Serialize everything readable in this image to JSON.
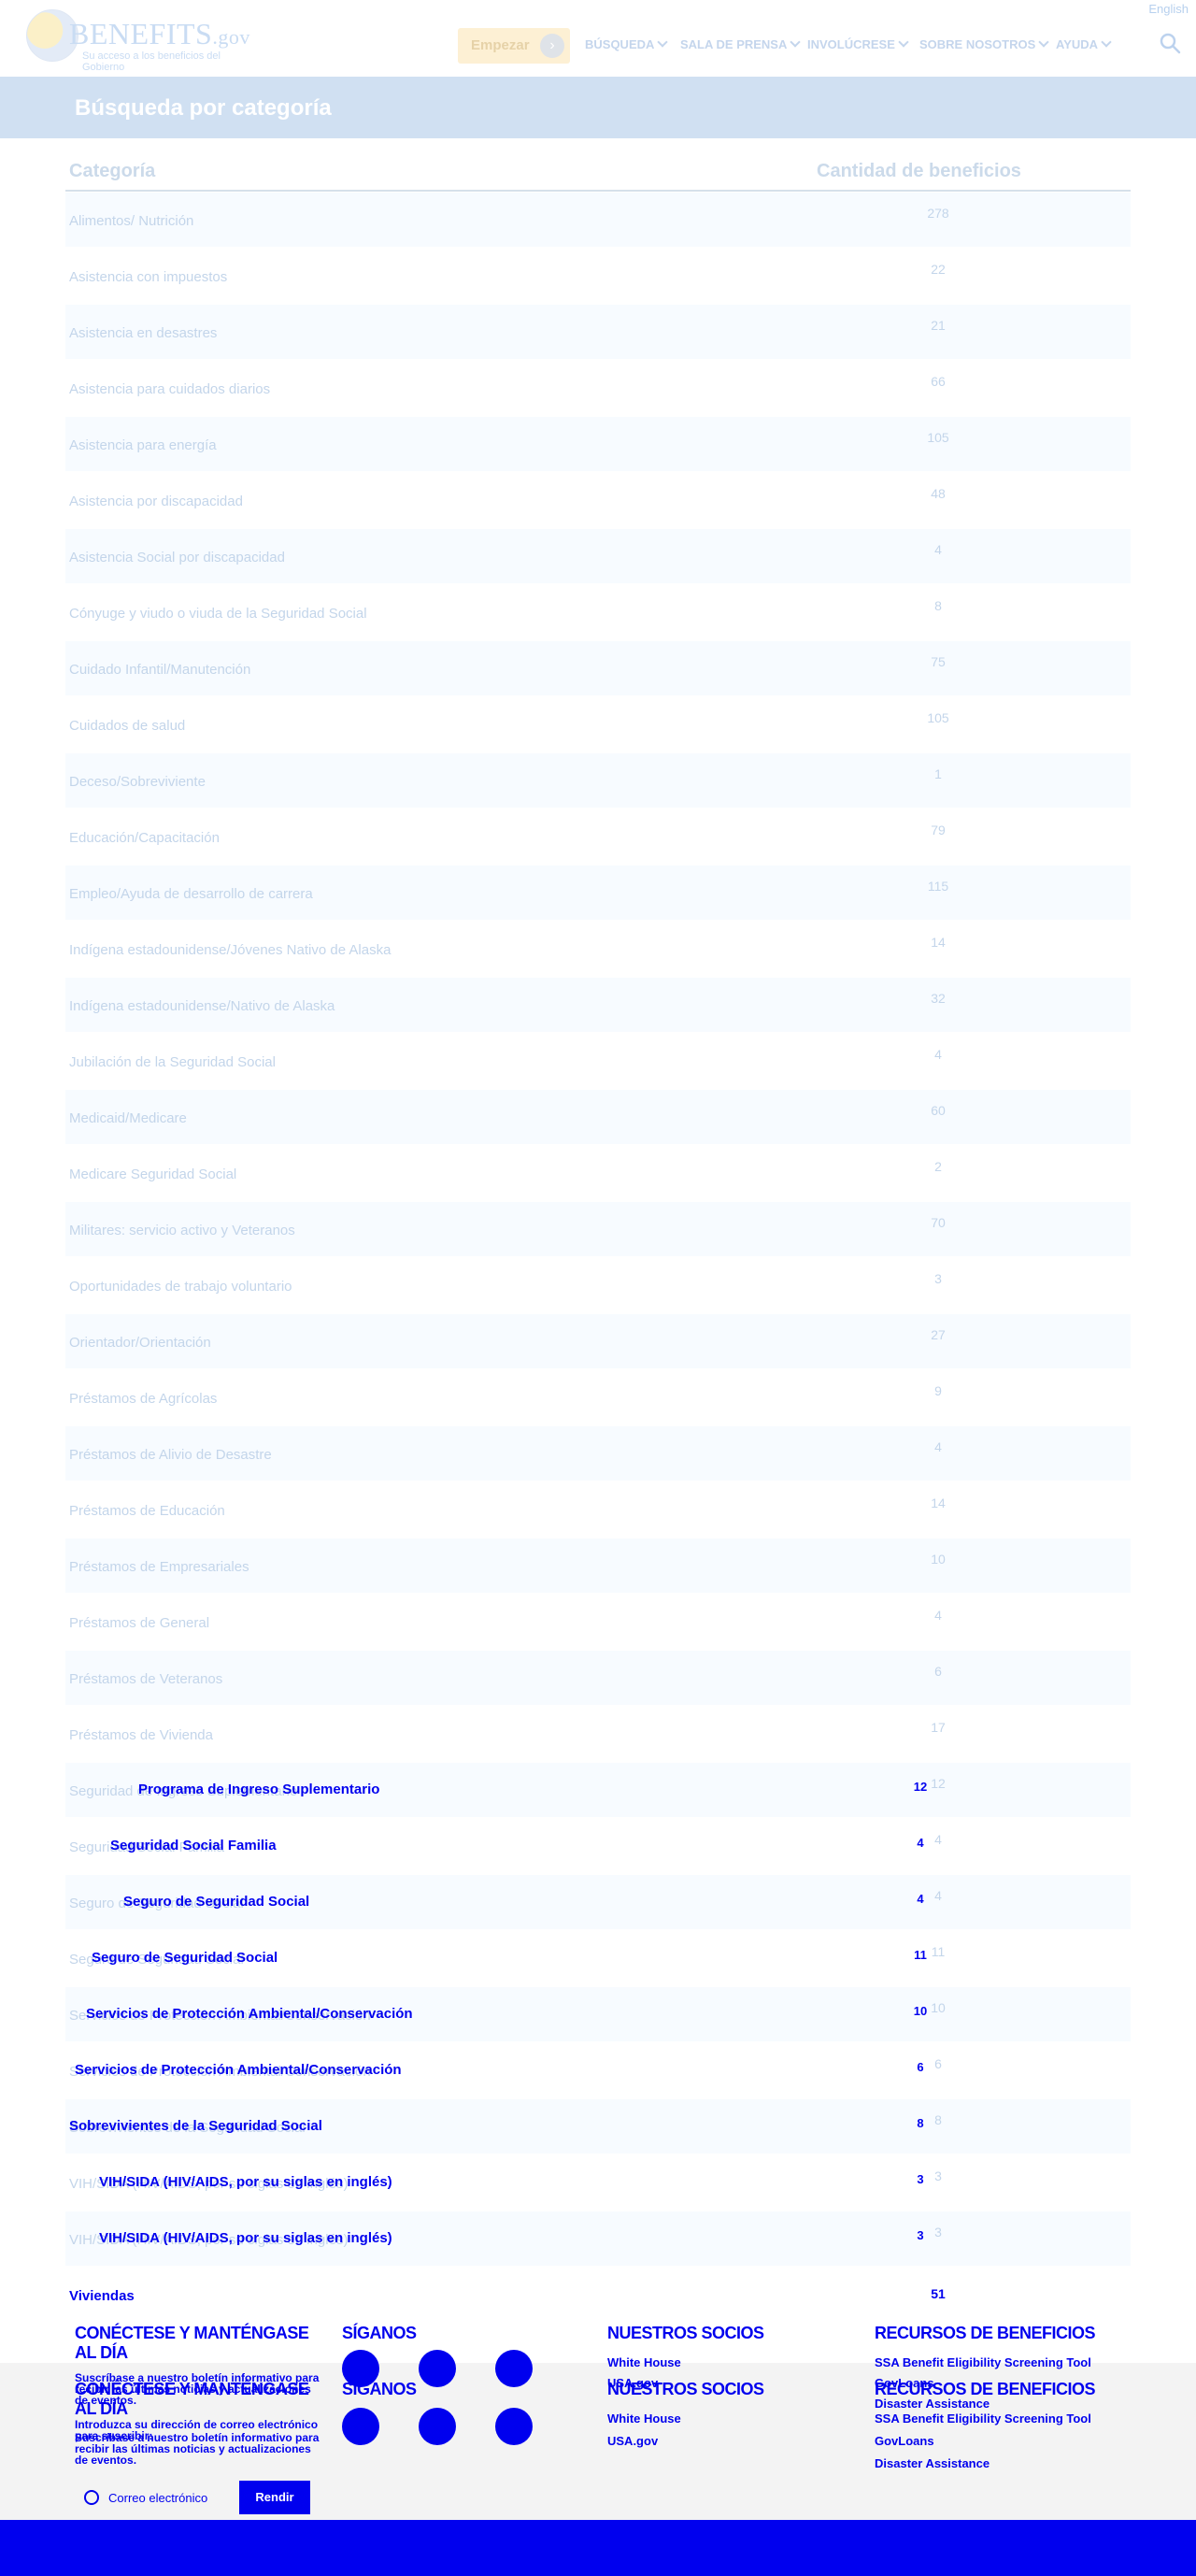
{
  "header": {
    "language_link": "English",
    "logo_text": "BENEFITS",
    "logo_suffix": ".gov",
    "logo_tagline": "Su acceso a los beneficios del Gobierno",
    "start_button": "Empezar",
    "nav": [
      "BÚSQUEDA",
      "SALA DE PRENSA",
      "INVOLÚCRESE",
      "SOBRE NOSOTROS",
      "AYUDA"
    ]
  },
  "banner": {
    "title": "Búsqueda por categoría"
  },
  "table": {
    "headers": {
      "category": "Categoría",
      "count": "Cantidad de beneficios"
    },
    "rows": [
      {
        "name": "Alimentos/ Nutrición",
        "count": "278"
      },
      {
        "name": "Asistencia con impuestos",
        "count": "22"
      },
      {
        "name": "Asistencia en desastres",
        "count": "21"
      },
      {
        "name": "Asistencia para cuidados diarios",
        "count": "66"
      },
      {
        "name": "Asistencia para energía",
        "count": "105"
      },
      {
        "name": "Asistencia por discapacidad",
        "count": "48"
      },
      {
        "name": "Asistencia Social por discapacidad",
        "count": "4"
      },
      {
        "name": "Cónyuge y viudo o viuda de la Seguridad Social",
        "count": "8"
      },
      {
        "name": "Cuidado Infantil/Manutención",
        "count": "75"
      },
      {
        "name": "Cuidados de salud",
        "count": "105"
      },
      {
        "name": "Deceso/Sobreviviente",
        "count": "1"
      },
      {
        "name": "Educación/Capacitación",
        "count": "79"
      },
      {
        "name": "Empleo/Ayuda de desarrollo de carrera",
        "count": "115"
      },
      {
        "name": "Indígena estadounidense/Jóvenes Nativo de Alaska",
        "count": "14"
      },
      {
        "name": "Indígena estadounidense/Nativo de Alaska",
        "count": "32"
      },
      {
        "name": "Jubilación de la Seguridad Social",
        "count": "4"
      },
      {
        "name": "Medicaid/Medicare",
        "count": "60"
      },
      {
        "name": "Medicare Seguridad Social",
        "count": "2"
      },
      {
        "name": "Militares: servicio activo y Veteranos",
        "count": "70"
      },
      {
        "name": "Oportunidades de trabajo voluntario",
        "count": "3"
      },
      {
        "name": "Orientador/Orientación",
        "count": "27"
      },
      {
        "name": "Préstamos de Agrícolas",
        "count": "9"
      },
      {
        "name": "Préstamos de Alivio de Desastre",
        "count": "4"
      },
      {
        "name": "Préstamos de Educación",
        "count": "14"
      },
      {
        "name": "Préstamos de Empresariales",
        "count": "10"
      },
      {
        "name": "Préstamos de General",
        "count": "4"
      },
      {
        "name": "Préstamos de Veteranos",
        "count": "6"
      },
      {
        "name": "Préstamos de Vivienda",
        "count": "17"
      },
      {
        "name": "Seguridad de Ingreso Suplementario",
        "count": "12"
      },
      {
        "name": "Seguridad Social Familia",
        "count": "4"
      },
      {
        "name": "Seguro de Seguridad Social",
        "count": "4"
      },
      {
        "name": "Seguro de Seguridad Social",
        "count": "11"
      },
      {
        "name": "Servicios de Protección Ambiental/Conservación",
        "count": "10"
      },
      {
        "name": "Servicios de Protección Ambiental/Conservación",
        "count": "6"
      },
      {
        "name": "Sobrevivientes de la Seguridad Social",
        "count": "8"
      },
      {
        "name": "VIH/SIDA (HIV/AIDS, por su siglas en inglés)",
        "count": "3"
      },
      {
        "name": "VIH/SIDA (HIV/AIDS, por su siglas en inglés)",
        "count": "3"
      },
      {
        "name": "Viviendas",
        "count": "51"
      }
    ]
  },
  "overlay_rows": [
    {
      "name": "Programa de Ingreso Suplementario",
      "count": "12"
    },
    {
      "name": "Seguridad Social Familia",
      "count": "4"
    },
    {
      "name": "Seguro de Seguridad Social",
      "count": "4"
    },
    {
      "name": "Seguro de Seguridad Social",
      "count": "11"
    },
    {
      "name": "Servicios de Protección Ambiental/Conservación",
      "count": "10"
    },
    {
      "name": "Servicios de Protección Ambiental/Conservación",
      "count": "6"
    },
    {
      "name": "Sobrevivientes de la Seguridad Social",
      "count": "8"
    },
    {
      "name": "VIH/SIDA (HIV/AIDS, por su siglas en inglés)",
      "count": "3"
    },
    {
      "name": "VIH/SIDA (HIV/AIDS, por su siglas en inglés)",
      "count": "3"
    }
  ],
  "footer": {
    "connect_title": "CONÉCTESE Y MANTÉNGASE AL DÍA",
    "connect_text": "Suscríbase a nuestro boletín informativo para recibir las últimas noticias y actualizaciones de eventos.",
    "email_instruction": "Introduzca su dirección de correo electrónico para suscribir:",
    "email_placeholder": "Correo electrónico",
    "submit_label": "Rendir",
    "follow_title": "SÍGANOS",
    "partners_title": "NUESTROS SOCIOS",
    "partners": [
      "White House",
      "USA.gov"
    ],
    "resources_title": "RECURSOS DE BENEFICIOS",
    "resources": [
      "SSA Benefit Eligibility Screening Tool",
      "GovLoans",
      "Disaster Assistance"
    ]
  },
  "colors": {
    "link_blue": "#0000ee",
    "banner": "#d0e0f2",
    "row_alt": "#f7fbff"
  }
}
